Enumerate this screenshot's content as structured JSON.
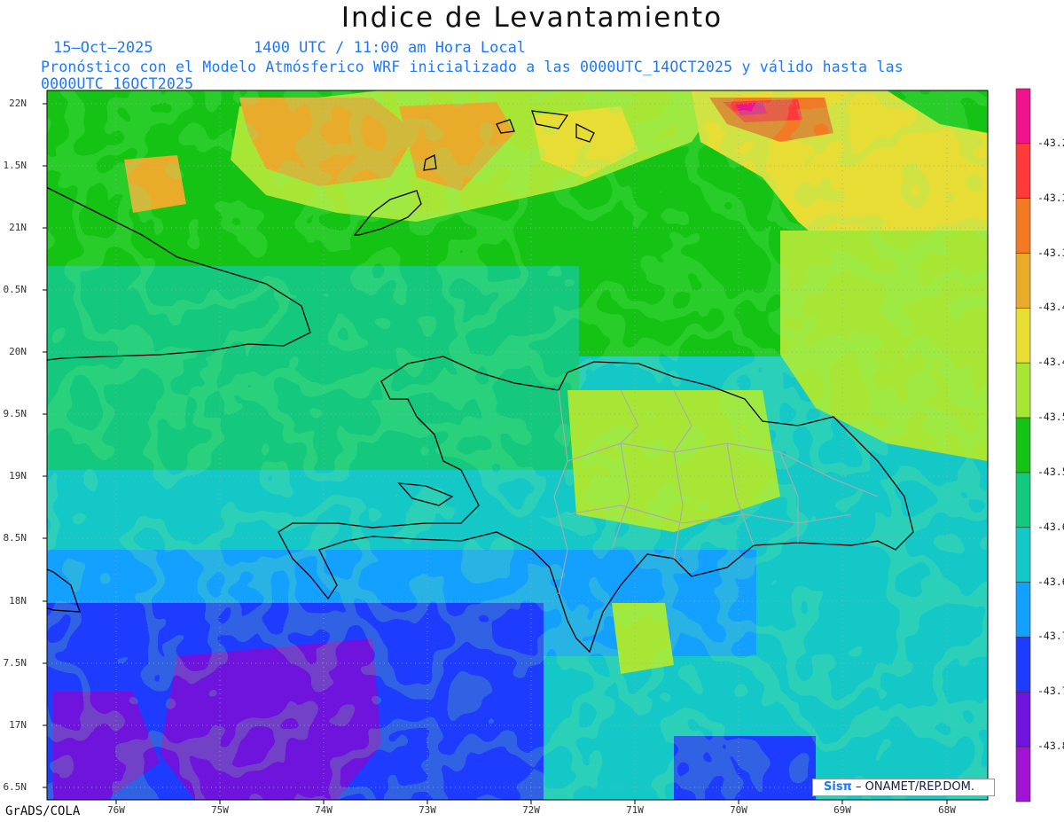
{
  "title": "Indice de Levantamiento",
  "subtitle_date": "15–Oct–2025",
  "subtitle_time": "1400 UTC / 11:00 am Hora Local",
  "subtitle_model": "Pronóstico con el Modelo Atmósferico WRF inicializado a las 0000UTC_14OCT2025 y válido hasta las  0000UTC_16OCT2025",
  "text_color": "#1e78ff",
  "credit": "GrADS/COLA",
  "brand": {
    "logo": "Sisπ",
    "separator": " – ",
    "org": "ONAMET/REP.DOM."
  },
  "axes": {
    "lat_labels": [
      "22N",
      "1.5N",
      "21N",
      "0.5N",
      "20N",
      "9.5N",
      "19N",
      "8.5N",
      "18N",
      "7.5N",
      "17N",
      "6.5N"
    ],
    "lon_labels": [
      "76W",
      "75W",
      "74W",
      "73W",
      "72W",
      "71W",
      "70W",
      "69W",
      "68W"
    ]
  },
  "colorbar": {
    "labels": [
      "-43.2",
      "-43.3",
      "-43.3",
      "-43.4",
      "-43.4",
      "-43.5",
      "-43.5",
      "-43.6",
      "-43.6",
      "-43.7",
      "-43.7",
      "-43.8"
    ],
    "colors": [
      "#f0148c",
      "#ff3a3a",
      "#f27a25",
      "#e8ab2a",
      "#e8dd35",
      "#a8e635",
      "#14c314",
      "#14c87e",
      "#15c8c8",
      "#14a0ff",
      "#1e3cff",
      "#6e14dc",
      "#a014d2"
    ]
  }
}
